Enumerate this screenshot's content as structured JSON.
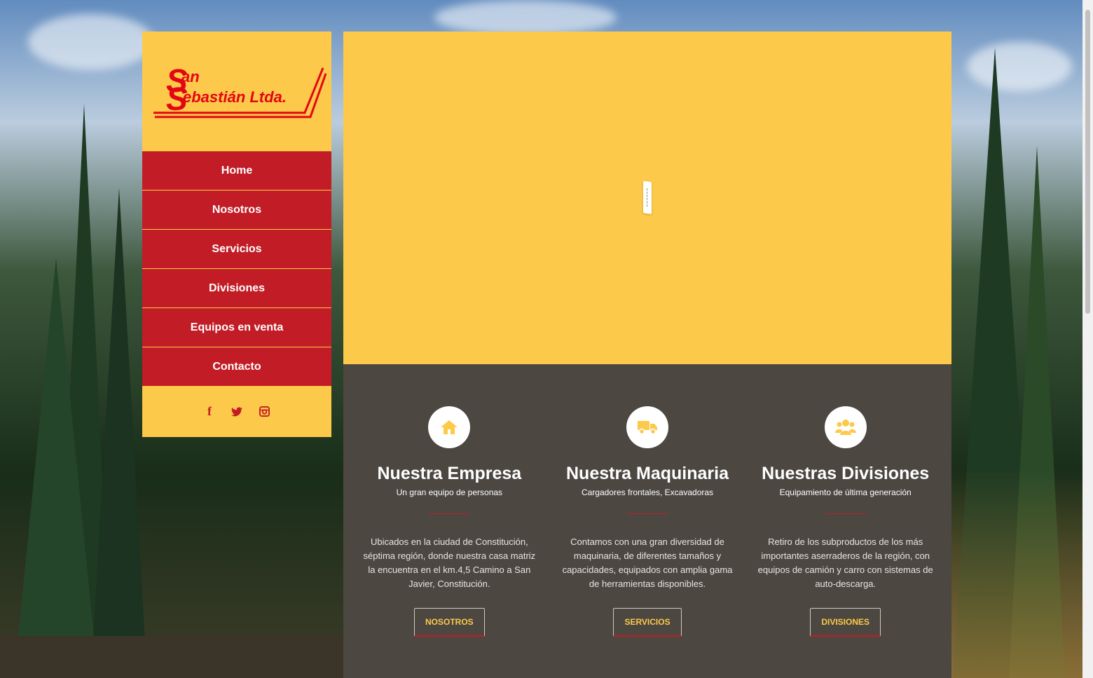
{
  "logo": {
    "line1": "San",
    "line2": "Sebastián Ltda."
  },
  "nav": [
    {
      "label": "Home"
    },
    {
      "label": "Nosotros"
    },
    {
      "label": "Servicios"
    },
    {
      "label": "Divisiones"
    },
    {
      "label": "Equipos en venta"
    },
    {
      "label": "Contacto"
    }
  ],
  "social": {
    "facebook": "f"
  },
  "features": [
    {
      "icon": "home-icon",
      "title": "Nuestra Empresa",
      "subtitle": "Un gran equipo de personas",
      "text": "Ubicados en la ciudad de Constitución, séptima región, donde nuestra casa matriz la encuentra en el km.4,5 Camino a San Javier, Constitución.",
      "button": "NOSOTROS"
    },
    {
      "icon": "truck-icon",
      "title": "Nuestra Maquinaria",
      "subtitle": "Cargadores frontales, Excavadoras",
      "text": "Contamos con una gran diversidad de maquinaria, de diferentes tamaños y capacidades, equipados con amplia gama de herramientas disponibles.",
      "button": "SERVICIOS"
    },
    {
      "icon": "users-icon",
      "title": "Nuestras Divisiones",
      "subtitle": "Equipamiento de última generación",
      "text": "Retiro de los subproductos de los más importantes aserraderos de la región, con equipos de camión y carro con sistemas de auto-descarga.",
      "button": "DIVISIONES"
    }
  ],
  "colors": {
    "brand_red": "#c21d26",
    "brand_yellow": "#fdc94a",
    "dark_panel": "#4c4741"
  }
}
